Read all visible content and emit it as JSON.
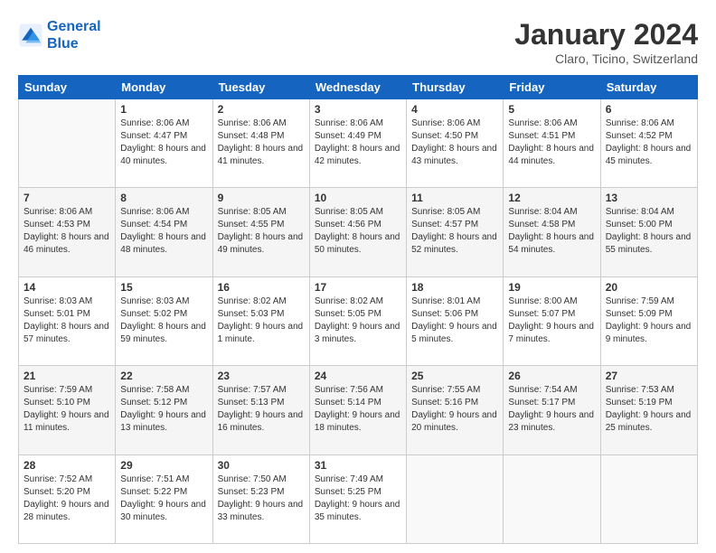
{
  "header": {
    "logo_line1": "General",
    "logo_line2": "Blue",
    "month": "January 2024",
    "location": "Claro, Ticino, Switzerland"
  },
  "days_of_week": [
    "Sunday",
    "Monday",
    "Tuesday",
    "Wednesday",
    "Thursday",
    "Friday",
    "Saturday"
  ],
  "weeks": [
    [
      {
        "day": "",
        "sunrise": "",
        "sunset": "",
        "daylight": "",
        "empty": true
      },
      {
        "day": "1",
        "sunrise": "Sunrise: 8:06 AM",
        "sunset": "Sunset: 4:47 PM",
        "daylight": "Daylight: 8 hours and 40 minutes.",
        "empty": false
      },
      {
        "day": "2",
        "sunrise": "Sunrise: 8:06 AM",
        "sunset": "Sunset: 4:48 PM",
        "daylight": "Daylight: 8 hours and 41 minutes.",
        "empty": false
      },
      {
        "day": "3",
        "sunrise": "Sunrise: 8:06 AM",
        "sunset": "Sunset: 4:49 PM",
        "daylight": "Daylight: 8 hours and 42 minutes.",
        "empty": false
      },
      {
        "day": "4",
        "sunrise": "Sunrise: 8:06 AM",
        "sunset": "Sunset: 4:50 PM",
        "daylight": "Daylight: 8 hours and 43 minutes.",
        "empty": false
      },
      {
        "day": "5",
        "sunrise": "Sunrise: 8:06 AM",
        "sunset": "Sunset: 4:51 PM",
        "daylight": "Daylight: 8 hours and 44 minutes.",
        "empty": false
      },
      {
        "day": "6",
        "sunrise": "Sunrise: 8:06 AM",
        "sunset": "Sunset: 4:52 PM",
        "daylight": "Daylight: 8 hours and 45 minutes.",
        "empty": false
      }
    ],
    [
      {
        "day": "7",
        "sunrise": "Sunrise: 8:06 AM",
        "sunset": "Sunset: 4:53 PM",
        "daylight": "Daylight: 8 hours and 46 minutes.",
        "empty": false
      },
      {
        "day": "8",
        "sunrise": "Sunrise: 8:06 AM",
        "sunset": "Sunset: 4:54 PM",
        "daylight": "Daylight: 8 hours and 48 minutes.",
        "empty": false
      },
      {
        "day": "9",
        "sunrise": "Sunrise: 8:05 AM",
        "sunset": "Sunset: 4:55 PM",
        "daylight": "Daylight: 8 hours and 49 minutes.",
        "empty": false
      },
      {
        "day": "10",
        "sunrise": "Sunrise: 8:05 AM",
        "sunset": "Sunset: 4:56 PM",
        "daylight": "Daylight: 8 hours and 50 minutes.",
        "empty": false
      },
      {
        "day": "11",
        "sunrise": "Sunrise: 8:05 AM",
        "sunset": "Sunset: 4:57 PM",
        "daylight": "Daylight: 8 hours and 52 minutes.",
        "empty": false
      },
      {
        "day": "12",
        "sunrise": "Sunrise: 8:04 AM",
        "sunset": "Sunset: 4:58 PM",
        "daylight": "Daylight: 8 hours and 54 minutes.",
        "empty": false
      },
      {
        "day": "13",
        "sunrise": "Sunrise: 8:04 AM",
        "sunset": "Sunset: 5:00 PM",
        "daylight": "Daylight: 8 hours and 55 minutes.",
        "empty": false
      }
    ],
    [
      {
        "day": "14",
        "sunrise": "Sunrise: 8:03 AM",
        "sunset": "Sunset: 5:01 PM",
        "daylight": "Daylight: 8 hours and 57 minutes.",
        "empty": false
      },
      {
        "day": "15",
        "sunrise": "Sunrise: 8:03 AM",
        "sunset": "Sunset: 5:02 PM",
        "daylight": "Daylight: 8 hours and 59 minutes.",
        "empty": false
      },
      {
        "day": "16",
        "sunrise": "Sunrise: 8:02 AM",
        "sunset": "Sunset: 5:03 PM",
        "daylight": "Daylight: 9 hours and 1 minute.",
        "empty": false
      },
      {
        "day": "17",
        "sunrise": "Sunrise: 8:02 AM",
        "sunset": "Sunset: 5:05 PM",
        "daylight": "Daylight: 9 hours and 3 minutes.",
        "empty": false
      },
      {
        "day": "18",
        "sunrise": "Sunrise: 8:01 AM",
        "sunset": "Sunset: 5:06 PM",
        "daylight": "Daylight: 9 hours and 5 minutes.",
        "empty": false
      },
      {
        "day": "19",
        "sunrise": "Sunrise: 8:00 AM",
        "sunset": "Sunset: 5:07 PM",
        "daylight": "Daylight: 9 hours and 7 minutes.",
        "empty": false
      },
      {
        "day": "20",
        "sunrise": "Sunrise: 7:59 AM",
        "sunset": "Sunset: 5:09 PM",
        "daylight": "Daylight: 9 hours and 9 minutes.",
        "empty": false
      }
    ],
    [
      {
        "day": "21",
        "sunrise": "Sunrise: 7:59 AM",
        "sunset": "Sunset: 5:10 PM",
        "daylight": "Daylight: 9 hours and 11 minutes.",
        "empty": false
      },
      {
        "day": "22",
        "sunrise": "Sunrise: 7:58 AM",
        "sunset": "Sunset: 5:12 PM",
        "daylight": "Daylight: 9 hours and 13 minutes.",
        "empty": false
      },
      {
        "day": "23",
        "sunrise": "Sunrise: 7:57 AM",
        "sunset": "Sunset: 5:13 PM",
        "daylight": "Daylight: 9 hours and 16 minutes.",
        "empty": false
      },
      {
        "day": "24",
        "sunrise": "Sunrise: 7:56 AM",
        "sunset": "Sunset: 5:14 PM",
        "daylight": "Daylight: 9 hours and 18 minutes.",
        "empty": false
      },
      {
        "day": "25",
        "sunrise": "Sunrise: 7:55 AM",
        "sunset": "Sunset: 5:16 PM",
        "daylight": "Daylight: 9 hours and 20 minutes.",
        "empty": false
      },
      {
        "day": "26",
        "sunrise": "Sunrise: 7:54 AM",
        "sunset": "Sunset: 5:17 PM",
        "daylight": "Daylight: 9 hours and 23 minutes.",
        "empty": false
      },
      {
        "day": "27",
        "sunrise": "Sunrise: 7:53 AM",
        "sunset": "Sunset: 5:19 PM",
        "daylight": "Daylight: 9 hours and 25 minutes.",
        "empty": false
      }
    ],
    [
      {
        "day": "28",
        "sunrise": "Sunrise: 7:52 AM",
        "sunset": "Sunset: 5:20 PM",
        "daylight": "Daylight: 9 hours and 28 minutes.",
        "empty": false
      },
      {
        "day": "29",
        "sunrise": "Sunrise: 7:51 AM",
        "sunset": "Sunset: 5:22 PM",
        "daylight": "Daylight: 9 hours and 30 minutes.",
        "empty": false
      },
      {
        "day": "30",
        "sunrise": "Sunrise: 7:50 AM",
        "sunset": "Sunset: 5:23 PM",
        "daylight": "Daylight: 9 hours and 33 minutes.",
        "empty": false
      },
      {
        "day": "31",
        "sunrise": "Sunrise: 7:49 AM",
        "sunset": "Sunset: 5:25 PM",
        "daylight": "Daylight: 9 hours and 35 minutes.",
        "empty": false
      },
      {
        "day": "",
        "sunrise": "",
        "sunset": "",
        "daylight": "",
        "empty": true
      },
      {
        "day": "",
        "sunrise": "",
        "sunset": "",
        "daylight": "",
        "empty": true
      },
      {
        "day": "",
        "sunrise": "",
        "sunset": "",
        "daylight": "",
        "empty": true
      }
    ]
  ]
}
